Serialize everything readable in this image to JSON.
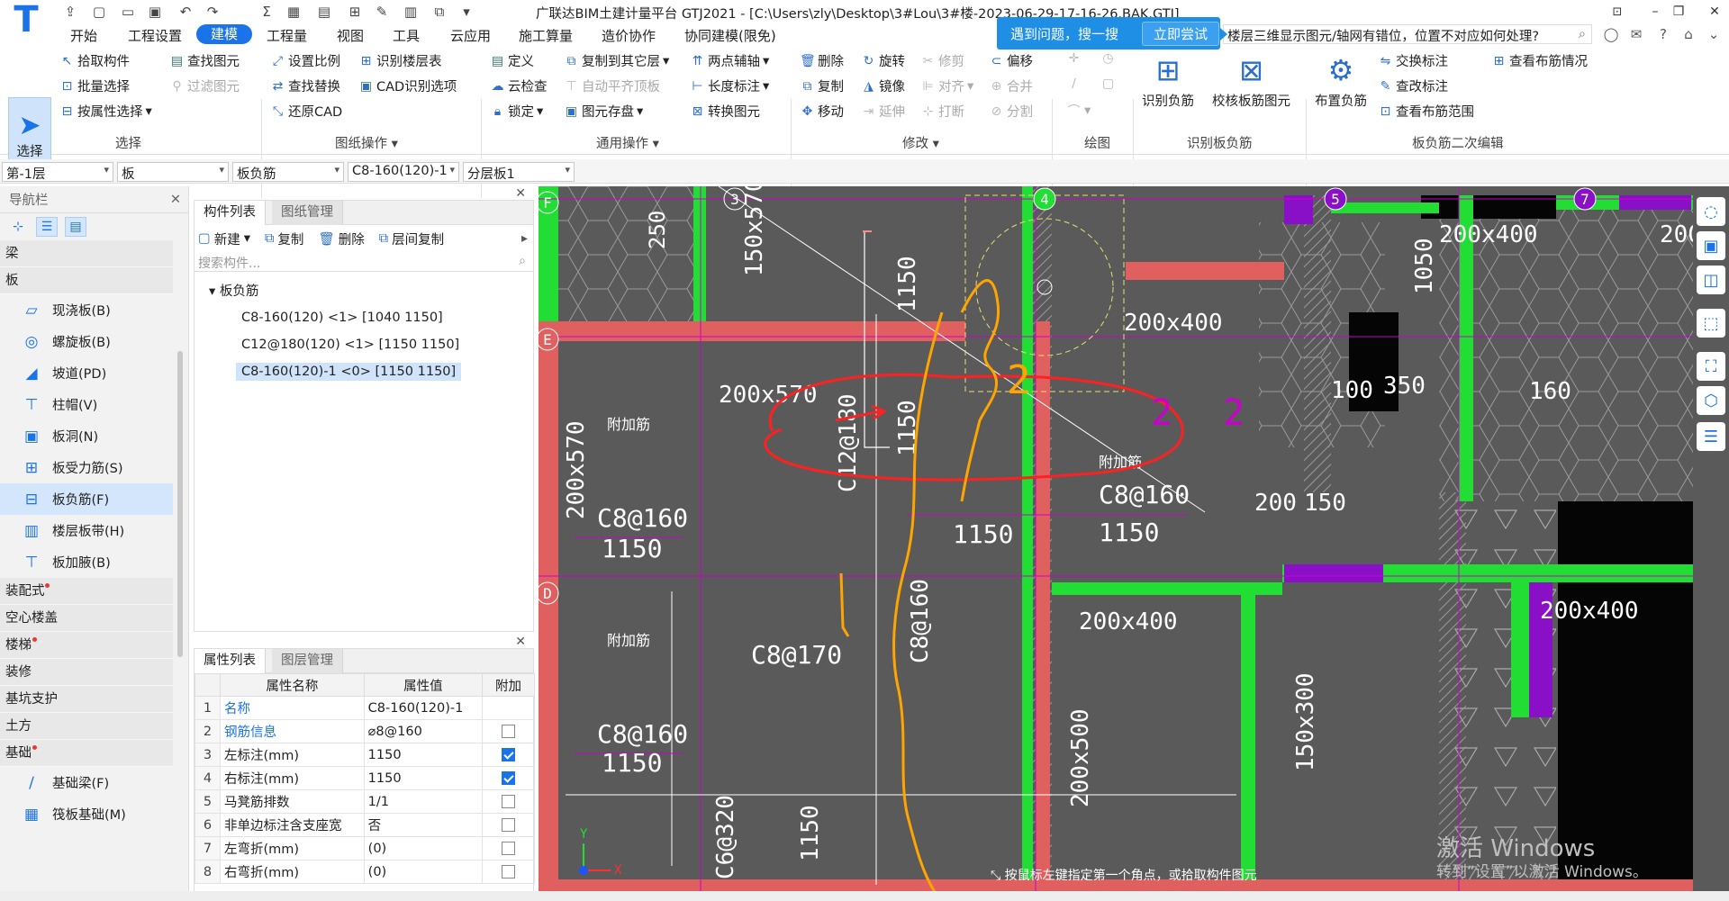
{
  "title_bar": {
    "app_title": "广联达BIM土建计量平台 GTJ2021 - [C:\\Users\\zly\\Desktop\\3#Lou\\3#楼-2023-06-29-17-16-26.BAK.GTJ]",
    "help_popup": {
      "text": "遇到问题，搜一搜",
      "button": "立即尝试"
    },
    "search_query": "楼层三维显示图元/轴网有错位，位置不对应如何处理?"
  },
  "menu": [
    "开始",
    "工程设置",
    "建模",
    "工程量",
    "视图",
    "工具",
    "云应用",
    "施工算量",
    "造价协作",
    "协同建模(限免)"
  ],
  "menu_active": "建模",
  "ribbon": {
    "select_group": {
      "big": "选择",
      "items": [
        "拾取构件",
        "批量选择",
        "按属性选择"
      ],
      "items2": [
        "查找图元",
        "过滤图元"
      ],
      "label": "选择"
    },
    "drawing_group": {
      "items": [
        "设置比例",
        "查找替换",
        "还原CAD"
      ],
      "items2": [
        "识别楼层表",
        "CAD识别选项"
      ],
      "label": "图纸操作"
    },
    "common_group": {
      "items": [
        "定义",
        "云检查",
        "锁定"
      ],
      "items2": [
        "复制到其它层",
        "自动平齐顶板",
        "图元存盘"
      ],
      "items3": [
        "两点辅轴",
        "长度标注",
        "转换图元"
      ],
      "label": "通用操作"
    },
    "modify_group": {
      "items": [
        "删除",
        "复制",
        "移动"
      ],
      "items2": [
        "旋转",
        "镜像",
        "延伸"
      ],
      "items3": [
        "修剪",
        "对齐",
        "打断"
      ],
      "items4": [
        "偏移",
        "合并",
        "分割"
      ],
      "label": "修改"
    },
    "draw_group": {
      "label": "绘图"
    },
    "recognize_group": {
      "items": [
        "识别负筋",
        "校核板筋图元"
      ],
      "label": "识别板负筋"
    },
    "secondary_group": {
      "big": "布置负筋",
      "items": [
        "交换标注",
        "查改标注",
        "查看布筋范围"
      ],
      "items2": [
        "查看布筋情况"
      ],
      "label": "板负筋二次编辑"
    }
  },
  "selectors": [
    "第-1层",
    "板",
    "板负筋",
    "C8-160(120)-1",
    "分层板1"
  ],
  "nav": {
    "header": "导航栏",
    "categories_top": [
      "梁",
      "板"
    ],
    "board_items": [
      "现浇板(B)",
      "螺旋板(B)",
      "坡道(PD)",
      "柱帽(V)",
      "板洞(N)",
      "板受力筋(S)",
      "板负筋(F)",
      "楼层板带(H)",
      "板加腋(B)"
    ],
    "categories_bottom": [
      "装配式",
      "空心楼盖",
      "楼梯",
      "装修",
      "基坑支护",
      "土方",
      "基础"
    ],
    "foundation_items": [
      "基础梁(F)",
      "筏板基础(M)"
    ]
  },
  "component_list": {
    "tabs": [
      "构件列表",
      "图纸管理"
    ],
    "toolbar": [
      "新建",
      "复制",
      "删除",
      "层间复制"
    ],
    "search_placeholder": "搜索构件...",
    "root": "板负筋",
    "items": [
      "C8-160(120) <1> [1040 1150]",
      "C12@180(120) <1> [1150 1150]",
      "C8-160(120)-1 <0> [1150 1150]"
    ]
  },
  "properties": {
    "tabs": [
      "属性列表",
      "图层管理"
    ],
    "headers": [
      "属性名称",
      "属性值",
      "附加"
    ],
    "rows": [
      {
        "n": "1",
        "name": "名称",
        "value": "C8-160(120)-1"
      },
      {
        "n": "2",
        "name": "钢筋信息",
        "value": "⌀8@160"
      },
      {
        "n": "3",
        "name": "左标注(mm)",
        "value": "1150"
      },
      {
        "n": "4",
        "name": "右标注(mm)",
        "value": "1150"
      },
      {
        "n": "5",
        "name": "马凳筋排数",
        "value": "1/1"
      },
      {
        "n": "6",
        "name": "非单边标注含支座宽",
        "value": "否"
      },
      {
        "n": "7",
        "name": "左弯折(mm)",
        "value": "(0)"
      },
      {
        "n": "8",
        "name": "右弯折(mm)",
        "value": "(0)"
      }
    ]
  },
  "canvas": {
    "axis_labels": [
      "F",
      "E",
      "D",
      "3",
      "4",
      "5",
      "7"
    ],
    "beam_labels": [
      "200x570",
      "200x400",
      "150x570",
      "200x500",
      "150x300"
    ],
    "rebar_labels": [
      "C8@160",
      "C8@170",
      "C12@180",
      "C6@320",
      "C8@160"
    ],
    "dim_labels": [
      "1150",
      "1050",
      "350",
      "100",
      "160",
      "200",
      "150",
      "250"
    ],
    "annotations": [
      "附加筋",
      "2"
    ],
    "hint": "按鼠标左键指定第一个角点，或拾取构件图元"
  },
  "watermark": {
    "line1": "激活 Windows",
    "line2": "转到“设置”以激活 Windows。"
  },
  "colors": {
    "accent": "#1a73e8",
    "canvas": "#5a5a5a",
    "beam_red": "#e06060",
    "wall_green": "#22dd33",
    "annot_orange": "#ffa500",
    "circle_red": "#ff2020",
    "magenta": "#cc00cc"
  }
}
